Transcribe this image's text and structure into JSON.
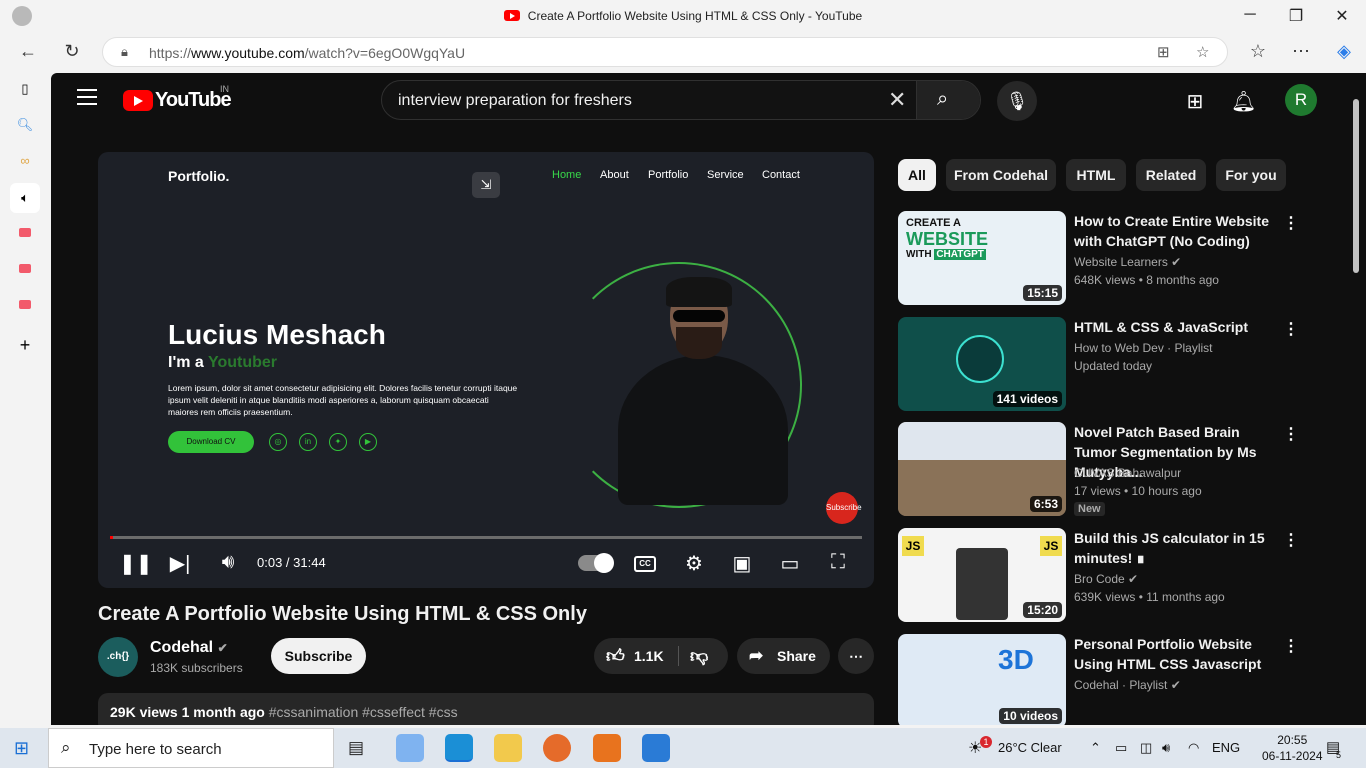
{
  "window": {
    "title": "Create A Portfolio Website Using HTML & CSS Only - YouTube",
    "minimize": "─",
    "restore": "❐",
    "close": "✕"
  },
  "browser": {
    "url_prefix": "https://",
    "url_host": "www.youtube.com",
    "url_path": "/watch?v=6egO0WgqYaU"
  },
  "youtube": {
    "logo_text": "YouTube",
    "country_code": "IN",
    "search_query": "interview preparation for freshers",
    "avatar_letter": "R"
  },
  "player": {
    "video_brand": "Portfolio.",
    "video_nav": [
      "Home",
      "About",
      "Portfolio",
      "Service",
      "Contact"
    ],
    "hero_name": "Lucius Meshach",
    "hero_role_prefix": "I'm a",
    "hero_role_word": "Youtuber",
    "hero_text": "Lorem ipsum, dolor sit amet consectetur adipisicing elit. Dolores facilis tenetur corrupti itaque ipsum velit deleniti in atque blanditiis modi asperiores a, laborum quisquam obcaecati maiores rem officiis praesentium.",
    "cv_button": "Download CV",
    "subscribe_badge": "Subscribe",
    "progress": 0.002,
    "time": "0:03 / 31:44",
    "cc_label": "CC"
  },
  "video": {
    "title": "Create A Portfolio Website Using HTML & CSS Only",
    "channel": "Codehal",
    "channel_avatar": ".ch{}",
    "subscribers": "183K subscribers",
    "subscribe_label": "Subscribe",
    "likes": "1.1K",
    "share_label": "Share",
    "views": "29K views",
    "age": "1 month ago",
    "tags": "#cssanimation #csseffect #css"
  },
  "chips": [
    "All",
    "From Codehal",
    "HTML",
    "Related",
    "For you"
  ],
  "recommendations": [
    {
      "title": "How to Create Entire Website with ChatGPT (No Coding)",
      "channel": "Website Learners",
      "meta": "648K views • 8 months ago",
      "duration": "15:15",
      "color": "#e9f1f6"
    },
    {
      "title": "HTML & CSS & JavaScript",
      "channel": "How to Web Dev · Playlist",
      "meta": "Updated today",
      "duration": "141 videos",
      "color": "#0f4f4a"
    },
    {
      "title": "Novel Patch Based Brain Tumor Segmentation by Ms Mutyyba...",
      "channel": "CUVAS Bahawalpur",
      "meta": "17 views • 10 hours ago",
      "duration": "6:53",
      "badge": "New",
      "color": "#6c5a48"
    },
    {
      "title": "Build this JS calculator in 15 minutes! ∎",
      "channel": "Bro Code",
      "meta": "639K views • 11 months ago",
      "duration": "15:20",
      "color": "#f4f4f4"
    },
    {
      "title": "Personal Portfolio Website Using HTML CSS Javascript",
      "channel": "Codehal · Playlist",
      "meta": "",
      "duration": "10 videos",
      "color": "#dfeaf5"
    }
  ],
  "taskbar": {
    "search_placeholder": "Type here to search",
    "weather": "26°C  Clear",
    "weather_alert": "1",
    "language": "ENG",
    "time": "20:55",
    "date": "06-11-2024",
    "notifications": "5"
  }
}
